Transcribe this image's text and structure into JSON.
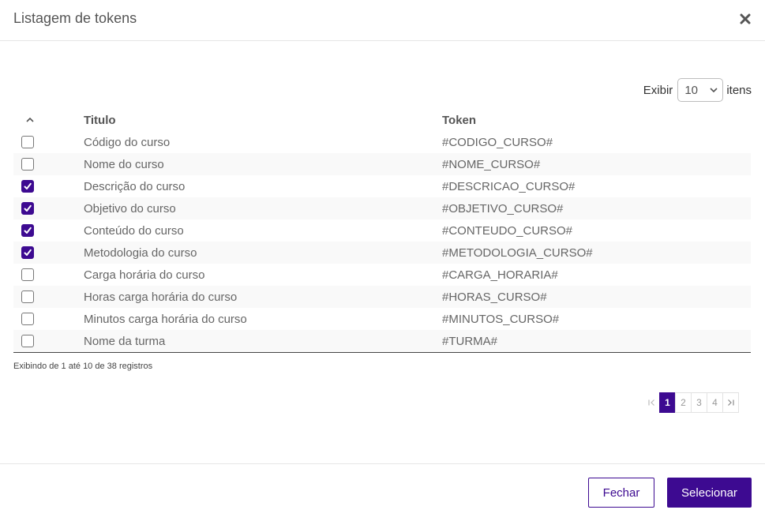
{
  "dialog": {
    "title": "Listagem de tokens"
  },
  "length": {
    "prefix": "Exibir",
    "value": "10",
    "suffix": "itens"
  },
  "table": {
    "headers": {
      "title": "Titulo",
      "token": "Token"
    },
    "rows": [
      {
        "title": "Código do curso",
        "token": "#CODIGO_CURSO#",
        "checked": false
      },
      {
        "title": "Nome do curso",
        "token": "#NOME_CURSO#",
        "checked": false
      },
      {
        "title": "Descrição do curso",
        "token": "#DESCRICAO_CURSO#",
        "checked": true
      },
      {
        "title": "Objetivo do curso",
        "token": "#OBJETIVO_CURSO#",
        "checked": true
      },
      {
        "title": "Conteúdo do curso",
        "token": "#CONTEUDO_CURSO#",
        "checked": true
      },
      {
        "title": "Metodologia do curso",
        "token": "#METODOLOGIA_CURSO#",
        "checked": true
      },
      {
        "title": "Carga horária do curso",
        "token": "#CARGA_HORARIA#",
        "checked": false
      },
      {
        "title": "Horas carga horária do curso",
        "token": "#HORAS_CURSO#",
        "checked": false
      },
      {
        "title": "Minutos carga horária do curso",
        "token": "#MINUTOS_CURSO#",
        "checked": false
      },
      {
        "title": "Nome da turma",
        "token": "#TURMA#",
        "checked": false
      }
    ]
  },
  "info": "Exibindo de 1 até 10 de 38 registros",
  "pagination": {
    "pages": [
      "1",
      "2",
      "3",
      "4"
    ],
    "active": "1",
    "first_icon": "first-page-icon",
    "last_icon": "last-page-icon"
  },
  "footer": {
    "close_label": "Fechar",
    "select_label": "Selecionar"
  },
  "colors": {
    "accent": "#3d0a91"
  }
}
